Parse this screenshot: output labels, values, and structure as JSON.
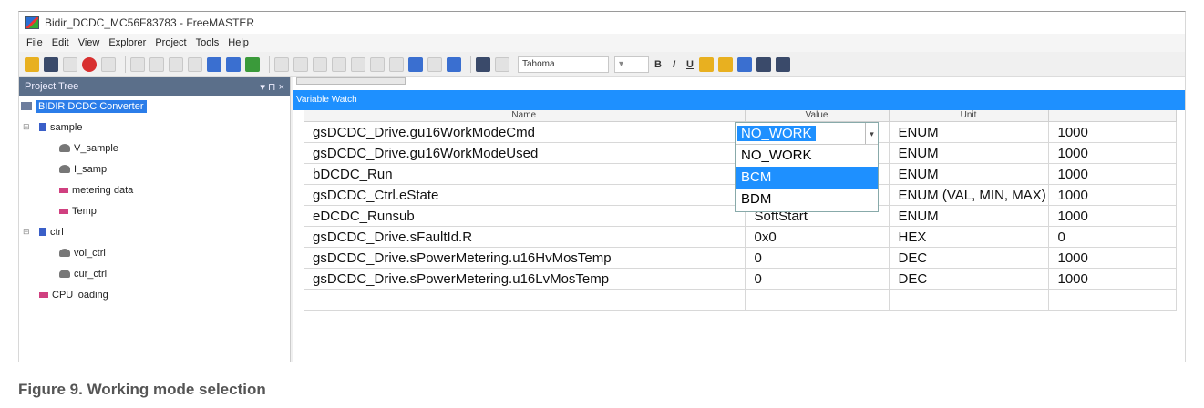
{
  "window": {
    "title": "Bidir_DCDC_MC56F83783 - FreeMASTER"
  },
  "menu": [
    "File",
    "Edit",
    "View",
    "Explorer",
    "Project",
    "Tools",
    "Help"
  ],
  "toolbar": {
    "font_name": "Tahoma",
    "bold": "B",
    "italic": "I",
    "underline": "U"
  },
  "project_tree": {
    "title": "Project Tree",
    "header_controls": "▾ ⊓ ×",
    "root": "BIDIR DCDC Converter",
    "items": [
      {
        "label": "sample",
        "level": 1
      },
      {
        "label": "V_sample",
        "level": 2
      },
      {
        "label": "I_samp",
        "level": 2
      },
      {
        "label": "metering data",
        "level": 2
      },
      {
        "label": "Temp",
        "level": 2
      },
      {
        "label": "ctrl",
        "level": 1
      },
      {
        "label": "vol_ctrl",
        "level": 2
      },
      {
        "label": "cur_ctrl",
        "level": 2
      },
      {
        "label": "CPU loading",
        "level": 1
      }
    ]
  },
  "variable_watch": {
    "title": "Variable Watch",
    "columns": [
      "Name",
      "Value",
      "Unit",
      ""
    ],
    "rows": [
      {
        "name": "gsDCDC_Drive.gu16WorkModeCmd",
        "value": "NO_WORK",
        "unit": "ENUM",
        "period": "1000"
      },
      {
        "name": "gsDCDC_Drive.gu16WorkModeUsed",
        "value": "NO_WORK",
        "unit": "ENUM",
        "period": "1000"
      },
      {
        "name": "bDCDC_Run",
        "value": "",
        "unit": "ENUM",
        "period": "1000"
      },
      {
        "name": "gsDCDC_Ctrl.eState",
        "value": "",
        "unit": "ENUM (VAL, MIN, MAX)",
        "period": "1000"
      },
      {
        "name": "eDCDC_Runsub",
        "value": "SoftStart",
        "unit": "ENUM",
        "period": "1000"
      },
      {
        "name": "gsDCDC_Drive.sFaultId.R",
        "value": "0x0",
        "unit": "HEX",
        "period": "0"
      },
      {
        "name": "gsDCDC_Drive.sPowerMetering.u16HvMosTemp",
        "value": "0",
        "unit": "DEC",
        "period": "1000"
      },
      {
        "name": "gsDCDC_Drive.sPowerMetering.u16LvMosTemp",
        "value": "0",
        "unit": "DEC",
        "period": "1000"
      }
    ],
    "dropdown": {
      "selected": "NO_WORK",
      "options": [
        "NO_WORK",
        "BCM",
        "BDM"
      ],
      "highlighted": "BCM"
    }
  },
  "caption": "Figure 9.  Working mode selection",
  "colors": {
    "accent": "#1e90ff",
    "tree_header": "#5b6f8a"
  }
}
